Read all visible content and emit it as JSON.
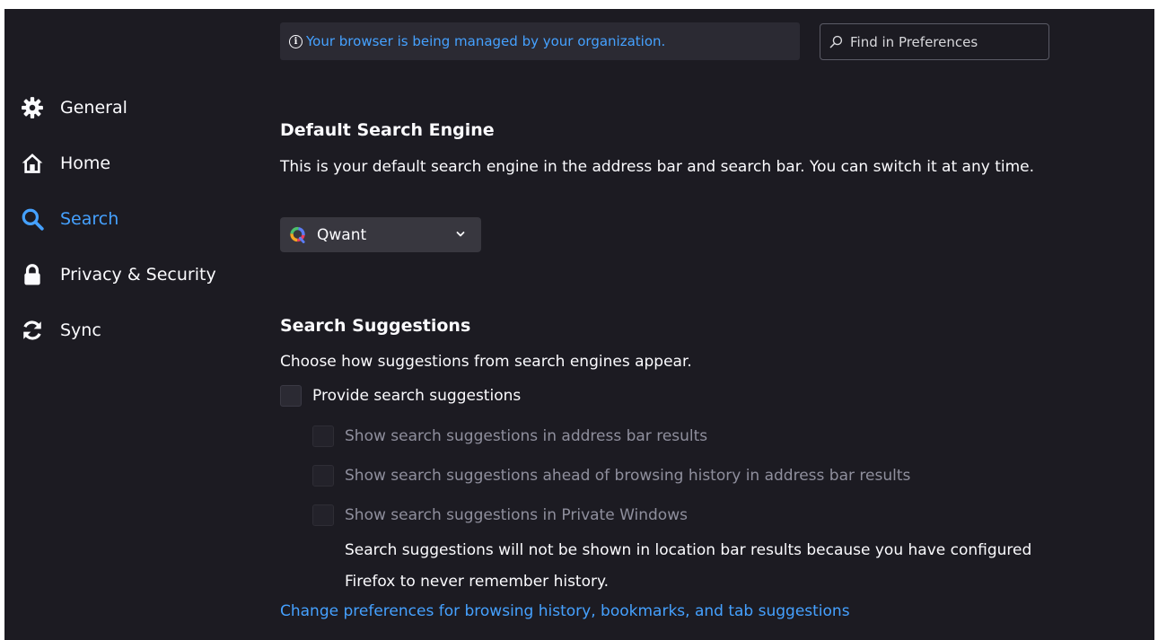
{
  "banner": {
    "icon": "info-icon",
    "text": "Your browser is being managed by your organization."
  },
  "find": {
    "icon": "search-icon",
    "placeholder": "Find in Preferences"
  },
  "sidebar": {
    "items": [
      {
        "label": "General",
        "icon": "gear-icon",
        "active": false
      },
      {
        "label": "Home",
        "icon": "home-icon",
        "active": false
      },
      {
        "label": "Search",
        "icon": "search-icon",
        "active": true
      },
      {
        "label": "Privacy & Security",
        "icon": "lock-icon",
        "active": false
      },
      {
        "label": "Sync",
        "icon": "sync-icon",
        "active": false
      }
    ]
  },
  "default_engine": {
    "heading": "Default Search Engine",
    "description": "This is your default search engine in the address bar and search bar. You can switch it at any time.",
    "selected": "Qwant",
    "selected_icon": "qwant-logo-icon"
  },
  "suggestions": {
    "heading": "Search Suggestions",
    "description": "Choose how suggestions from search engines appear.",
    "provide": {
      "label": "Provide search suggestions",
      "checked": false,
      "enabled": true
    },
    "sub_options": [
      {
        "label": "Show search suggestions in address bar results",
        "checked": false,
        "enabled": false
      },
      {
        "label": "Show search suggestions ahead of browsing history in address bar results",
        "checked": false,
        "enabled": false
      },
      {
        "label": "Show search suggestions in Private Windows",
        "checked": false,
        "enabled": false
      }
    ],
    "note": "Search suggestions will not be shown in location bar results because you have configured Firefox to never remember history.",
    "link": "Change preferences for browsing history, bookmarks, and tab suggestions"
  },
  "colors": {
    "background": "#1c1b22",
    "accent": "#45a1ff",
    "text": "#fbfbfe",
    "disabled_text": "#8f8f9d"
  }
}
